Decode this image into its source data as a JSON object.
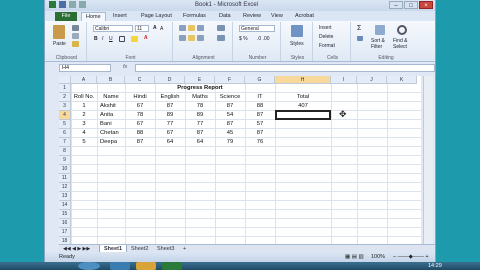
{
  "window": {
    "title": "Book1 - Microsoft Excel"
  },
  "tabs": [
    "File",
    "Home",
    "Insert",
    "Page Layout",
    "Formulas",
    "Data",
    "Review",
    "View",
    "Acrobat"
  ],
  "ribbon": {
    "clipboard_label": "Clipboard",
    "paste_label": "Paste",
    "font_label": "Font",
    "font_name": "Calibri",
    "font_size": "11",
    "alignment_label": "Alignment",
    "number_label": "Number",
    "number_format": "General",
    "styles_label": "Styles",
    "cells_label": "Cells",
    "insert_label": "Insert",
    "delete_label": "Delete",
    "format_label": "Format",
    "editing_label": "Editing",
    "sort_label": "Sort & Filter",
    "find_label": "Find & Select"
  },
  "formula_bar": {
    "name_box": "H4",
    "fx": "fx",
    "value": ""
  },
  "columns": [
    "A",
    "B",
    "C",
    "D",
    "E",
    "F",
    "G",
    "H",
    "I",
    "J",
    "K"
  ],
  "rows": [
    "1",
    "2",
    "3",
    "4",
    "5",
    "6",
    "7",
    "8",
    "9",
    "10",
    "11",
    "12",
    "13",
    "14",
    "15",
    "16",
    "17",
    "18"
  ],
  "sheet": {
    "title": "Progress Report",
    "headers": [
      "Roll No.",
      "Name",
      "Hindi",
      "English",
      "Maths",
      "Science",
      "IT",
      "Total"
    ],
    "records": [
      [
        "1",
        "Akshit",
        "67",
        "87",
        "78",
        "87",
        "88",
        "407"
      ],
      [
        "2",
        "Anita",
        "78",
        "89",
        "89",
        "54",
        "87",
        ""
      ],
      [
        "3",
        "Bani",
        "67",
        "77",
        "77",
        "87",
        "57",
        ""
      ],
      [
        "4",
        "Chetan",
        "88",
        "67",
        "87",
        "45",
        "87",
        ""
      ],
      [
        "5",
        "Deepa",
        "87",
        "64",
        "64",
        "79",
        "76",
        ""
      ]
    ]
  },
  "sheets": [
    "Sheet1",
    "Sheet2",
    "Sheet3"
  ],
  "status": {
    "ready": "Ready",
    "zoom": "100%"
  },
  "clock": "14:29"
}
